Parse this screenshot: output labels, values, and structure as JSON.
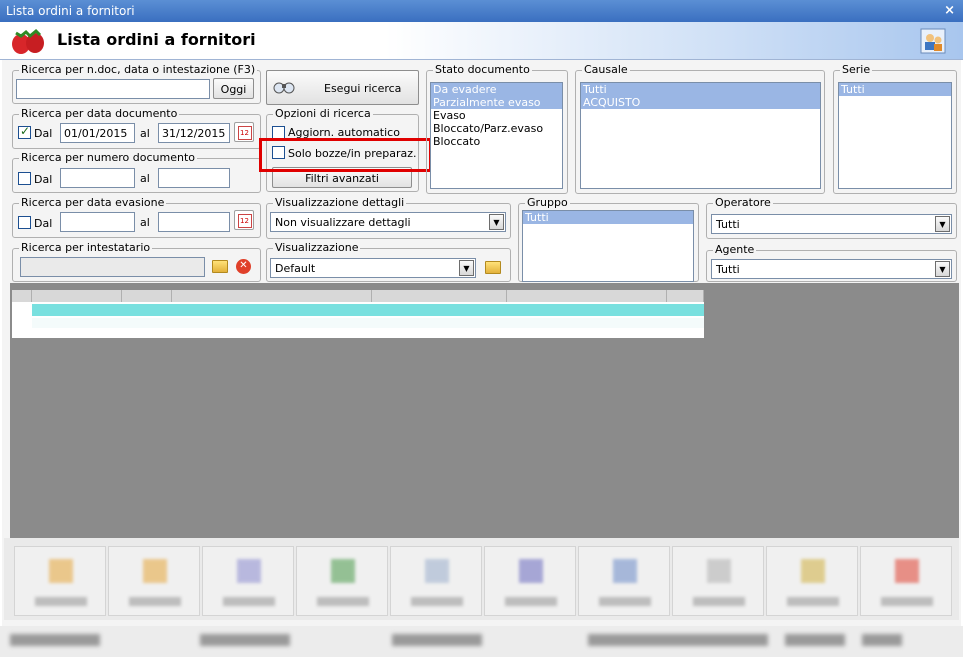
{
  "window": {
    "title": "Lista ordini a fornitori",
    "close_label": "×"
  },
  "header": {
    "title": "Lista ordini a fornitori",
    "logo_icon": "strawberry-icon",
    "action_icon": "users-icon"
  },
  "search_text": {
    "legend": "Ricerca per n.doc, data o intestazione (F3)",
    "value": "",
    "button": "Oggi"
  },
  "search_button": {
    "label": "Esegui ricerca",
    "icon": "binoculars-icon"
  },
  "date_doc": {
    "legend": "Ricerca per data documento",
    "checked": true,
    "from_label": "Dal",
    "from_value": "01/01/2015",
    "to_label": "al",
    "to_value": "31/12/2015"
  },
  "num_doc": {
    "legend": "Ricerca per numero documento",
    "checked": false,
    "from_label": "Dal",
    "from_value": "",
    "to_label": "al",
    "to_value": ""
  },
  "date_eva": {
    "legend": "Ricerca per data evasione",
    "checked": false,
    "from_label": "Dal",
    "from_value": "",
    "to_label": "al",
    "to_value": ""
  },
  "holder": {
    "legend": "Ricerca per intestatario",
    "value": ""
  },
  "options": {
    "legend": "Opzioni di ricerca",
    "auto_update": "Aggiorn. automatico",
    "drafts_only": "Solo bozze/in preparaz.",
    "advanced_filters": "Filtri avanzati"
  },
  "detail_view": {
    "legend": "Visualizzazione dettagli",
    "value": "Non visualizzare dettagli"
  },
  "view": {
    "legend": "Visualizzazione",
    "value": "Default"
  },
  "doc_state": {
    "legend": "Stato documento",
    "items": [
      {
        "label": "Da evadere",
        "selected": true
      },
      {
        "label": "Parzialmente evaso",
        "selected": true
      },
      {
        "label": "Evaso",
        "selected": false
      },
      {
        "label": "Bloccato/Parz.evaso",
        "selected": false
      },
      {
        "label": "Bloccato",
        "selected": false
      }
    ]
  },
  "causale": {
    "legend": "Causale",
    "items": [
      {
        "label": "Tutti",
        "selected": true
      },
      {
        "label": "ACQUISTO",
        "selected": true
      }
    ]
  },
  "serie": {
    "legend": "Serie",
    "items": [
      {
        "label": "Tutti",
        "selected": true
      }
    ]
  },
  "gruppo": {
    "legend": "Gruppo",
    "items": [
      {
        "label": "Tutti",
        "selected": true
      }
    ]
  },
  "operatore": {
    "legend": "Operatore",
    "value": "Tutti"
  },
  "agente": {
    "legend": "Agente",
    "value": "Tutti"
  }
}
